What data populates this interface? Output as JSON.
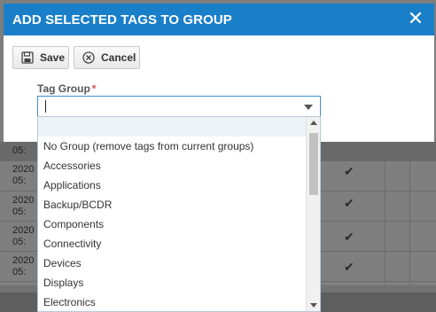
{
  "dialog": {
    "title": "ADD SELECTED TAGS TO GROUP",
    "close_label": "✕",
    "save_label": "Save",
    "cancel_label": "Cancel",
    "field_label": "Tag Group",
    "required_mark": "*",
    "select_value": "",
    "options": [
      "No Group (remove tags from current groups)",
      "Accessories",
      "Applications",
      "Backup/BCDR",
      "Components",
      "Connectivity",
      "Devices",
      "Displays",
      "Electronics"
    ]
  },
  "background_table": {
    "rows": [
      {
        "date": "2020",
        "time": "05:"
      },
      {
        "date": "2020",
        "time": "05:"
      },
      {
        "date": "2020",
        "time": "05:"
      },
      {
        "date": "2020",
        "time": "05:"
      }
    ],
    "first_partial_time": "05:",
    "check_glyph": "✔"
  },
  "colors": {
    "titlebar": "#1a7fc9",
    "overlay": "#7f7f7f",
    "focus_border": "#3f8fd2",
    "required": "#d9534f"
  }
}
